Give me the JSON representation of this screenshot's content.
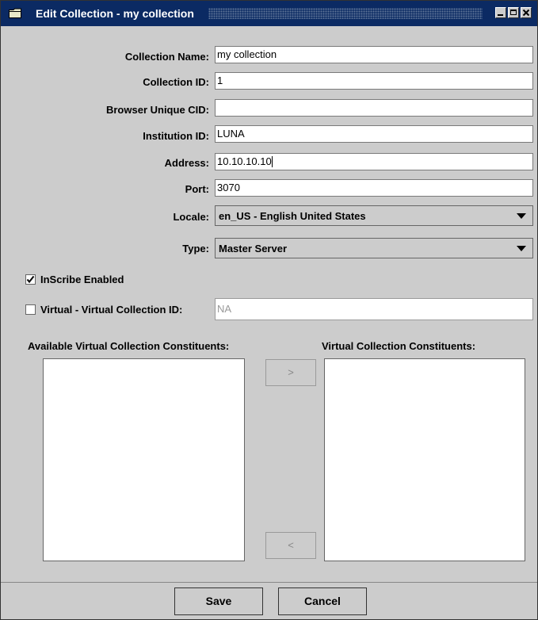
{
  "window": {
    "title": "Edit Collection - my collection",
    "icons": [
      "folder-icon",
      "minimize-icon",
      "maximize-icon",
      "close-icon"
    ],
    "colors": {
      "titlebar": "#0b2a63",
      "background": "#cccccc"
    }
  },
  "form": {
    "collection_name": {
      "label": "Collection Name:",
      "value": "my collection"
    },
    "collection_id": {
      "label": "Collection ID:",
      "value": "1"
    },
    "browser_cid": {
      "label": "Browser Unique CID:",
      "value": ""
    },
    "institution_id": {
      "label": "Institution ID:",
      "value": "LUNA"
    },
    "address": {
      "label": "Address:",
      "value": "10.10.10.10"
    },
    "port": {
      "label": "Port:",
      "value": "3070"
    },
    "locale": {
      "label": "Locale:",
      "selected": "en_US - English United States"
    },
    "type": {
      "label": "Type:",
      "selected": "Master Server"
    }
  },
  "inscribe": {
    "label": "InScribe Enabled",
    "checked": true
  },
  "virtual": {
    "label": "Virtual - Virtual Collection ID:",
    "checked": false,
    "value": "NA"
  },
  "lists": {
    "available_label": "Available Virtual Collection Constituents:",
    "constituents_label": "Virtual Collection Constituents:",
    "add_label": ">",
    "remove_label": "<"
  },
  "buttons": {
    "save": "Save",
    "cancel": "Cancel"
  }
}
